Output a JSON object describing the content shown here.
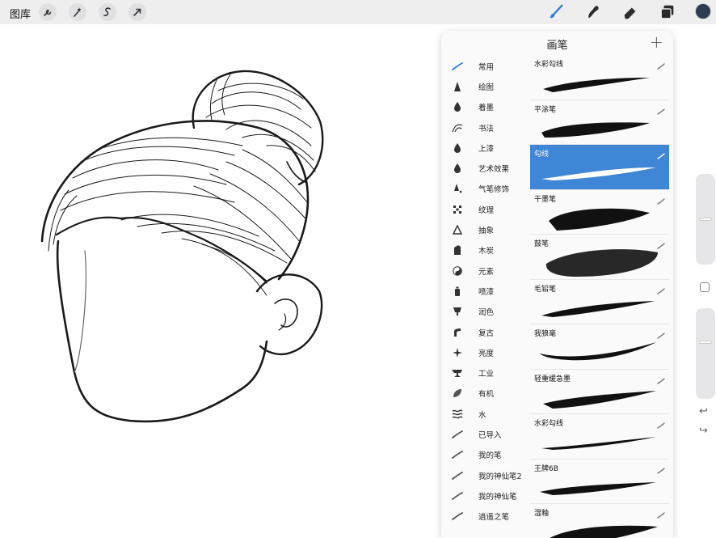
{
  "toolbar": {
    "gallery_label": "图库",
    "left_tools": [
      {
        "name": "actions",
        "icon": "wrench-icon"
      },
      {
        "name": "adjustments",
        "icon": "magic-wand-icon"
      },
      {
        "name": "selection",
        "icon": "selection-s-icon"
      },
      {
        "name": "transform",
        "icon": "arrow-cursor-icon"
      }
    ],
    "right_tools": [
      {
        "name": "paint",
        "icon": "brush-icon",
        "active": true
      },
      {
        "name": "smudge",
        "icon": "smudge-icon",
        "active": false
      },
      {
        "name": "erase",
        "icon": "eraser-icon",
        "active": false
      },
      {
        "name": "layers",
        "icon": "layers-icon",
        "active": false
      }
    ],
    "accent_color": "#2d7be0",
    "current_color": "#2d3b4e"
  },
  "brush_library": {
    "title": "画笔",
    "add_icon": "plus-icon",
    "sets": [
      {
        "label": "常用",
        "icon": "stroke-icon"
      },
      {
        "label": "绘图",
        "icon": "cone-icon"
      },
      {
        "label": "着墨",
        "icon": "ink-drop-icon"
      },
      {
        "label": "书法",
        "icon": "calligraphy-icon"
      },
      {
        "label": "上漆",
        "icon": "paint-drop-icon"
      },
      {
        "label": "艺术效果",
        "icon": "art-drop-icon"
      },
      {
        "label": "气笔修饰",
        "icon": "airbrush-icon"
      },
      {
        "label": "纹理",
        "icon": "texture-icon"
      },
      {
        "label": "抽象",
        "icon": "triangle-icon"
      },
      {
        "label": "木炭",
        "icon": "charcoal-icon"
      },
      {
        "label": "元素",
        "icon": "yin-yang-icon"
      },
      {
        "label": "喷漆",
        "icon": "spray-can-icon"
      },
      {
        "label": "润色",
        "icon": "shield-brush-icon"
      },
      {
        "label": "复古",
        "icon": "retro-icon"
      },
      {
        "label": "亮度",
        "icon": "sparkle-icon"
      },
      {
        "label": "工业",
        "icon": "anvil-icon"
      },
      {
        "label": "有机",
        "icon": "leaf-icon"
      },
      {
        "label": "水",
        "icon": "waves-icon"
      },
      {
        "label": "已导入",
        "icon": "stroke-icon"
      },
      {
        "label": "我的笔",
        "icon": "stroke-icon"
      },
      {
        "label": "我的神仙笔2",
        "icon": "stroke-icon"
      },
      {
        "label": "我的神仙笔",
        "icon": "stroke-icon"
      },
      {
        "label": "逍遥之笔",
        "icon": "stroke-icon"
      }
    ],
    "selected_set": "常用",
    "brushes": [
      {
        "name": "水彩勾线",
        "selected": false
      },
      {
        "name": "平涂笔",
        "selected": false
      },
      {
        "name": "勾线",
        "selected": true
      },
      {
        "name": "干墨笔",
        "selected": false
      },
      {
        "name": "鼓笔",
        "selected": false
      },
      {
        "name": "毛铅笔",
        "selected": false
      },
      {
        "name": "我狼毫",
        "selected": false
      },
      {
        "name": "轻重缓急墨",
        "selected": false
      },
      {
        "name": "水彩勾线",
        "selected": false
      },
      {
        "name": "王牌6B",
        "selected": false
      },
      {
        "name": "湿釉",
        "selected": false
      }
    ]
  },
  "sidebar": {
    "brush_size_level": 0.5,
    "opacity_level": 0.5,
    "undo_icon": "undo-icon",
    "redo_icon": "redo-icon"
  }
}
